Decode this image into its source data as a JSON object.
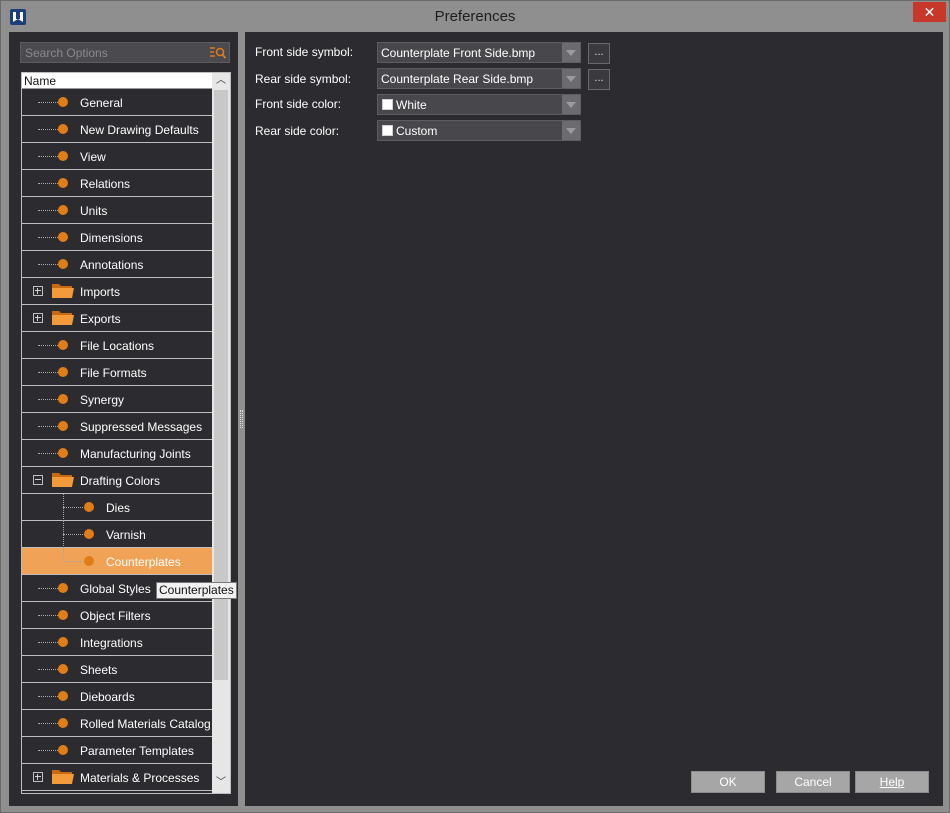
{
  "window": {
    "title": "Preferences",
    "close_glyph": "✕"
  },
  "search": {
    "placeholder": "Search Options"
  },
  "tree": {
    "header": "Name",
    "items": [
      {
        "label": "General",
        "kind": "leaf",
        "depth": 0
      },
      {
        "label": "New Drawing Defaults",
        "kind": "leaf",
        "depth": 0
      },
      {
        "label": "View",
        "kind": "leaf",
        "depth": 0
      },
      {
        "label": "Relations",
        "kind": "leaf",
        "depth": 0
      },
      {
        "label": "Units",
        "kind": "leaf",
        "depth": 0
      },
      {
        "label": "Dimensions",
        "kind": "leaf",
        "depth": 0
      },
      {
        "label": "Annotations",
        "kind": "leaf",
        "depth": 0
      },
      {
        "label": "Imports",
        "kind": "folder-collapsed",
        "depth": 0
      },
      {
        "label": "Exports",
        "kind": "folder-collapsed",
        "depth": 0
      },
      {
        "label": "File Locations",
        "kind": "leaf",
        "depth": 0
      },
      {
        "label": "File Formats",
        "kind": "leaf",
        "depth": 0
      },
      {
        "label": "Synergy",
        "kind": "leaf",
        "depth": 0
      },
      {
        "label": "Suppressed Messages",
        "kind": "leaf",
        "depth": 0
      },
      {
        "label": "Manufacturing Joints",
        "kind": "leaf",
        "depth": 0
      },
      {
        "label": "Drafting Colors",
        "kind": "folder-expanded",
        "depth": 0
      },
      {
        "label": "Dies",
        "kind": "leaf",
        "depth": 1
      },
      {
        "label": "Varnish",
        "kind": "leaf",
        "depth": 1
      },
      {
        "label": "Counterplates",
        "kind": "leaf",
        "depth": 1,
        "selected": true
      },
      {
        "label": "Global Styles",
        "kind": "leaf",
        "depth": 0
      },
      {
        "label": "Object Filters",
        "kind": "leaf",
        "depth": 0
      },
      {
        "label": "Integrations",
        "kind": "leaf",
        "depth": 0
      },
      {
        "label": "Sheets",
        "kind": "leaf",
        "depth": 0
      },
      {
        "label": "Dieboards",
        "kind": "leaf",
        "depth": 0
      },
      {
        "label": "Rolled Materials Catalog",
        "kind": "leaf",
        "depth": 0
      },
      {
        "label": "Parameter Templates",
        "kind": "leaf",
        "depth": 0
      },
      {
        "label": "Materials & Processes",
        "kind": "folder-collapsed",
        "depth": 0
      }
    ],
    "tooltip": "Counterplates",
    "scroll_up_glyph": "︿",
    "scroll_down_glyph": "﹀"
  },
  "settings": {
    "front_symbol_label": "Front side symbol:",
    "front_symbol_value": "Counterplate Front Side.bmp",
    "rear_symbol_label": "Rear side symbol:",
    "rear_symbol_value": "Counterplate Rear Side.bmp",
    "front_color_label": "Front side color:",
    "front_color_value": "White",
    "rear_color_label": "Rear side color:",
    "rear_color_value": "Custom",
    "browse_label": "..."
  },
  "buttons": {
    "ok": "OK",
    "cancel": "Cancel",
    "help": "Help"
  },
  "colors": {
    "accent_orange": "#e07d16",
    "selection": "#f0a257",
    "background": "#2b2b30"
  }
}
